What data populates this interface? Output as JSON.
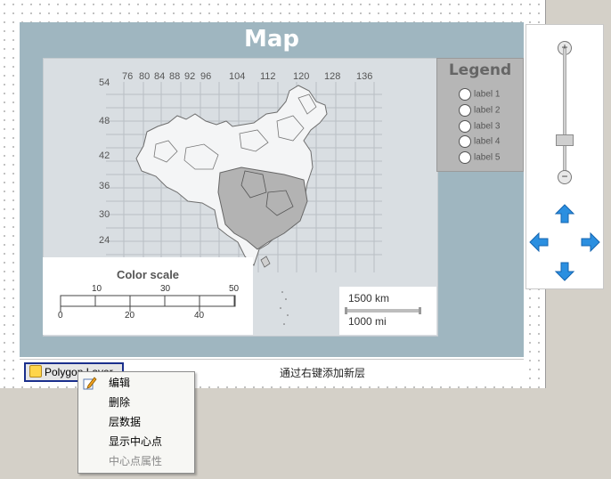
{
  "map": {
    "title": "Map",
    "lon_ticks": [
      "76",
      "80",
      "84",
      "88",
      "92",
      "96",
      "104",
      "112",
      "120",
      "128",
      "136"
    ],
    "lat_ticks": [
      "54",
      "48",
      "42",
      "36",
      "30",
      "24"
    ]
  },
  "legend": {
    "title": "Legend",
    "items": [
      "label 1",
      "label 2",
      "label 3",
      "label 4",
      "label 5"
    ]
  },
  "color_scale": {
    "title": "Color scale",
    "top_ticks": [
      "10",
      "30",
      "50"
    ],
    "bottom_ticks": [
      "0",
      "20",
      "40"
    ]
  },
  "scale_bar": {
    "km": "1500 km",
    "mi": "1000 mi"
  },
  "status": {
    "layer_name": "Polygon Layer",
    "hint": "通过右键添加新层"
  },
  "context_menu": {
    "items": [
      {
        "label": "编辑",
        "enabled": true
      },
      {
        "label": "删除",
        "enabled": true
      },
      {
        "label": "层数据",
        "enabled": true
      },
      {
        "label": "显示中心点",
        "enabled": true
      },
      {
        "label": "中心点属性",
        "enabled": false
      }
    ]
  },
  "navigation": {
    "zoom_in": "+",
    "zoom_out": "−"
  },
  "colors": {
    "panel": "#9fb6c0",
    "arrow": "#2b8fe0",
    "selection": "#1a2f8c"
  }
}
